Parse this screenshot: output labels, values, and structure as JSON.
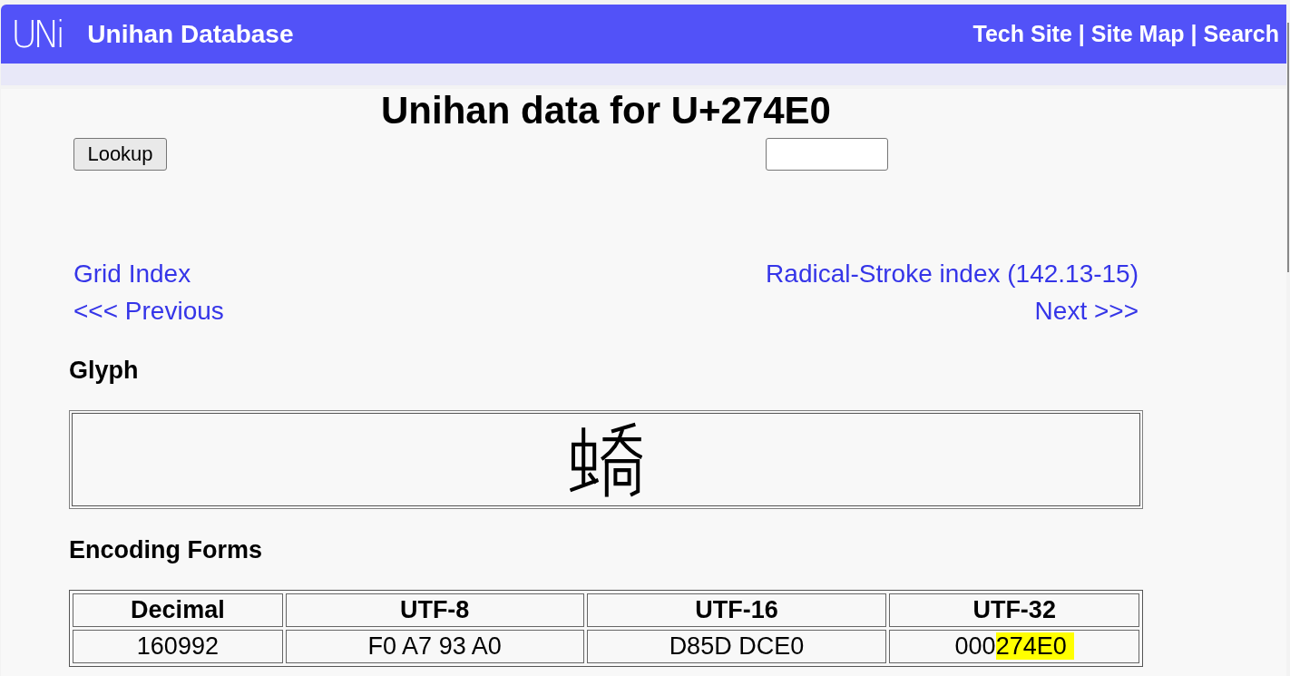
{
  "header": {
    "logo": "UNi",
    "title": "Unihan Database",
    "nav": [
      {
        "label": "Tech Site"
      },
      {
        "label": "Site Map"
      },
      {
        "label": "Search"
      }
    ],
    "separators": [
      "|",
      "|"
    ]
  },
  "page_title": "Unihan data for U+274E0",
  "lookup": {
    "button": "Lookup"
  },
  "navigation": {
    "grid_index": "Grid Index",
    "radical_stroke_index": "Radical-Stroke index (142.13-15)",
    "previous": "<<< Previous",
    "next": "Next >>>"
  },
  "glyph": {
    "heading": "Glyph"
  },
  "encoding_forms": {
    "heading": "Encoding Forms",
    "columns": [
      "Decimal",
      "UTF-8",
      "UTF-16",
      "UTF-32"
    ],
    "rows": [
      [
        {
          "text": "160992"
        },
        {
          "text": "F0 A7 93 A0"
        },
        {
          "text": "D85D DCE0"
        },
        {
          "text": "000",
          "highlight": "274E0"
        }
      ]
    ]
  }
}
